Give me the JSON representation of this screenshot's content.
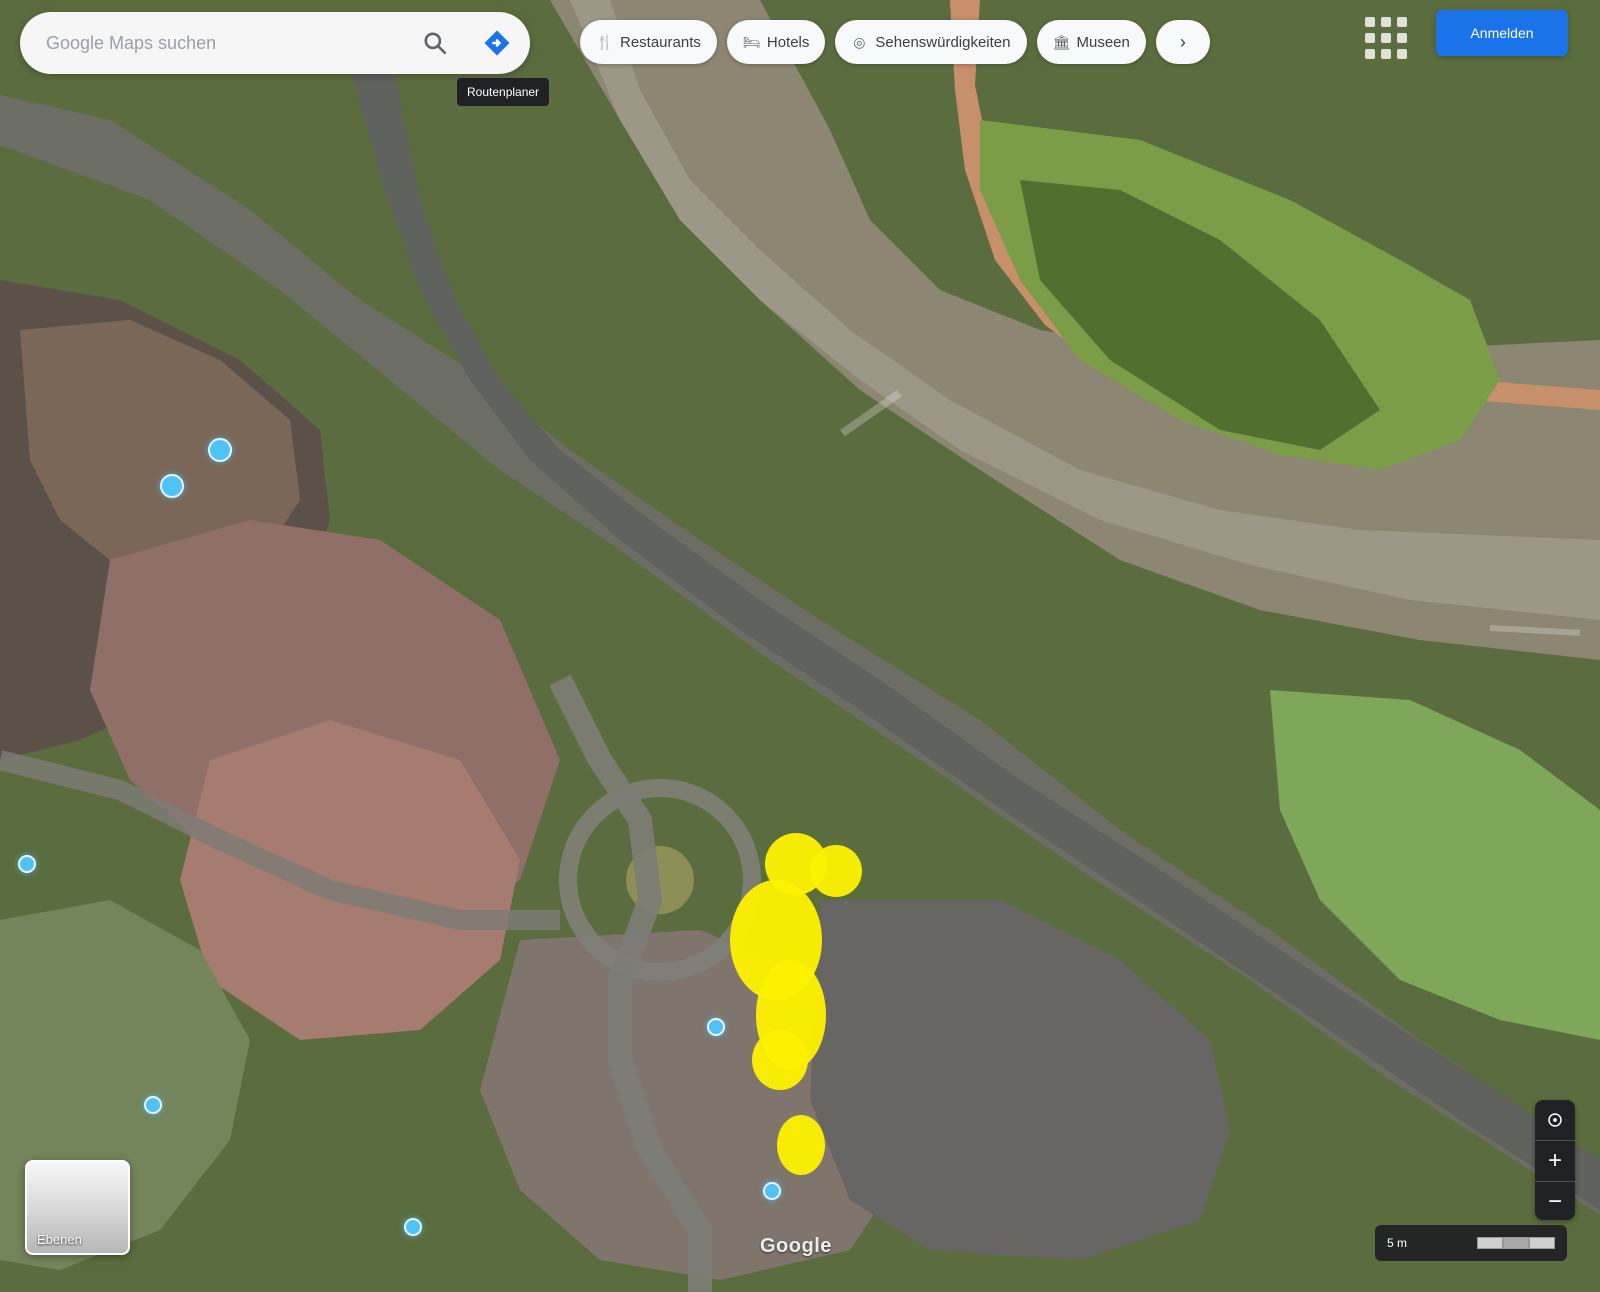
{
  "search": {
    "placeholder": "Google Maps suchen",
    "tooltip": "Routenplaner"
  },
  "chips": [
    {
      "label": "Restaurants",
      "icon": "restaurant-icon"
    },
    {
      "label": "Hotels",
      "icon": "hotel-icon"
    },
    {
      "label": "Sehenswürdigkeiten",
      "icon": "attraction-icon"
    },
    {
      "label": "Museen",
      "icon": "museum-icon"
    },
    {
      "label": "›",
      "icon": "chevron-right-icon"
    }
  ],
  "top_right": {
    "signin_label": "Anmelden",
    "apps_icon": "apps-icon"
  },
  "map": {
    "google_label": "Google",
    "layers_label": "Ebenen"
  },
  "controls": {
    "zoom_in": "+",
    "zoom_out": "−",
    "compass_icon": "compass-icon"
  },
  "footer": {
    "scale_label": "5 m"
  },
  "colors": {
    "accent": "#1a73e8",
    "highlight": "#fff200"
  }
}
